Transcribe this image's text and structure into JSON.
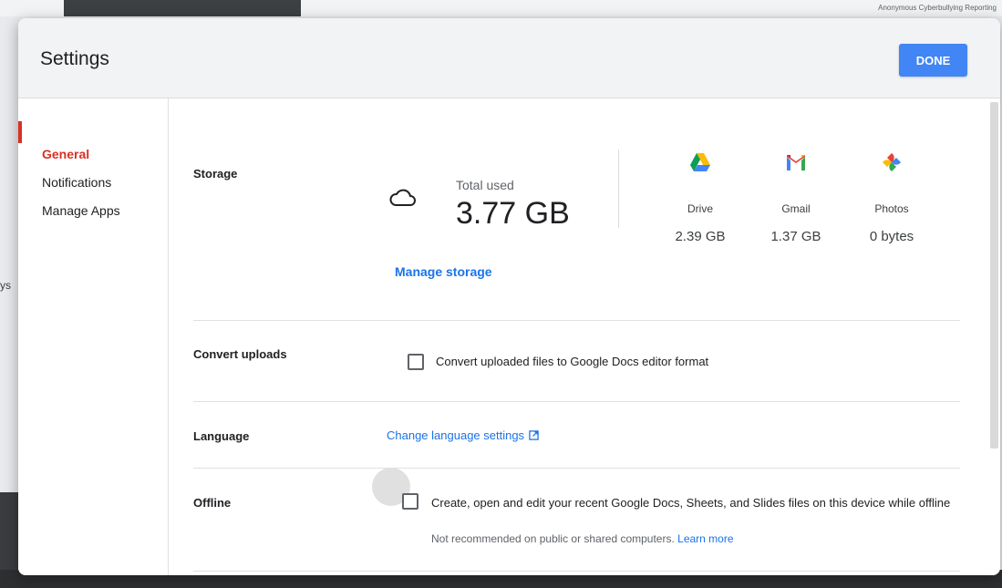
{
  "background": {
    "report_text": "Anonymous Cyberbullying Reporting",
    "side_text": "ys"
  },
  "modal": {
    "title": "Settings",
    "done_label": "DONE"
  },
  "sidebar": {
    "items": [
      {
        "label": "General",
        "active": true
      },
      {
        "label": "Notifications",
        "active": false
      },
      {
        "label": "Manage Apps",
        "active": false
      }
    ]
  },
  "storage": {
    "label": "Storage",
    "total_label": "Total used",
    "total_value": "3.77 GB",
    "manage_link": "Manage storage",
    "services": [
      {
        "name": "Drive",
        "size": "2.39 GB",
        "icon": "drive-icon"
      },
      {
        "name": "Gmail",
        "size": "1.37 GB",
        "icon": "gmail-icon"
      },
      {
        "name": "Photos",
        "size": "0 bytes",
        "icon": "photos-icon"
      }
    ]
  },
  "convert": {
    "label": "Convert uploads",
    "checkbox_text": "Convert uploaded files to Google Docs editor format",
    "checked": false
  },
  "language": {
    "label": "Language",
    "link_text": "Change language settings"
  },
  "offline": {
    "label": "Offline",
    "checkbox_text": "Create, open and edit your recent Google Docs, Sheets, and Slides files on this device while offline",
    "sub_text": "Not recommended on public or shared computers.",
    "learn_more": "Learn more",
    "checked": false
  },
  "colors": {
    "accent_red": "#d93025",
    "link_blue": "#1a73e8",
    "button_blue": "#4285f4"
  }
}
